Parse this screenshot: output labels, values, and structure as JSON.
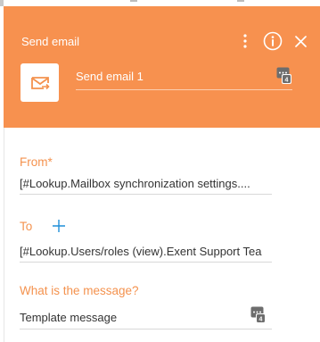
{
  "header": {
    "title": "Send email",
    "process_name": "Send email 1",
    "accent_color": "#f7914f",
    "icons": [
      "more-vertical-icon",
      "info-icon",
      "close-icon",
      "envelope-arrow-icon",
      "macro-icon"
    ]
  },
  "form": {
    "from": {
      "label": "From*",
      "value": "[#Lookup.Mailbox synchronization settings...."
    },
    "to": {
      "label": "To",
      "value": "[#Lookup.Users/roles (view).Exent Support Tea"
    },
    "message": {
      "label": "What is the message?",
      "value": "Template message"
    }
  }
}
